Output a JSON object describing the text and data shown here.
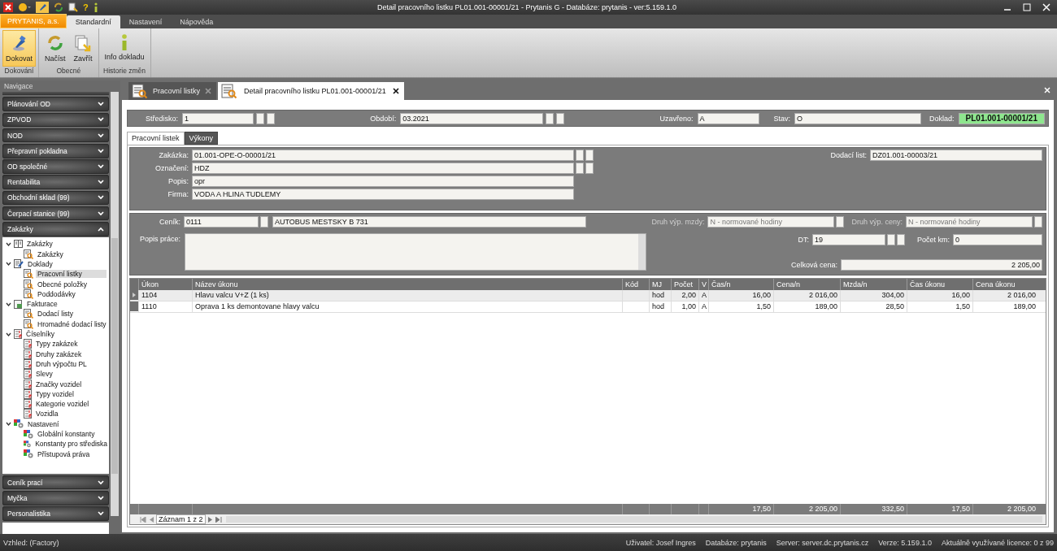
{
  "window": {
    "title": "Detail pracovního listku PL01.001-00001/21 - Prytanis G - Databáze: prytanis - ver:5.159.1.0",
    "help_glyph": "?"
  },
  "ribbon": {
    "app_tab": "PRYTANIS, a.s.",
    "tabs": [
      {
        "label": "Standardní",
        "selected": true
      },
      {
        "label": "Nastavení",
        "selected": false
      },
      {
        "label": "Nápověda",
        "selected": false
      }
    ],
    "groups": [
      {
        "label": "Dokování",
        "buttons": [
          {
            "label": "Dokovat",
            "selected": true
          }
        ]
      },
      {
        "label": "Obecné",
        "buttons": [
          {
            "label": "Načíst",
            "selected": false
          },
          {
            "label": "Zavřít",
            "selected": false
          }
        ]
      },
      {
        "label": "Historie změn",
        "buttons": [
          {
            "label": "Info dokladu",
            "selected": false
          }
        ]
      }
    ]
  },
  "navigation": {
    "title": "Navigace",
    "sections": [
      {
        "label": "Plánování OD",
        "expanded": false
      },
      {
        "label": "ZPVOD",
        "expanded": false
      },
      {
        "label": "NOD",
        "expanded": false
      },
      {
        "label": "Přepravní pokladna",
        "expanded": false
      },
      {
        "label": "OD společné",
        "expanded": false
      },
      {
        "label": "Rentabilita",
        "expanded": false
      },
      {
        "label": "Obchodní sklad (99)",
        "expanded": false
      },
      {
        "label": "Čerpací stanice (99)",
        "expanded": false
      },
      {
        "label": "Zakázky",
        "expanded": true,
        "children": [
          {
            "label": "Zakázky",
            "expanded": true,
            "children": [
              {
                "label": "Zakázky",
                "selected": false
              }
            ]
          },
          {
            "label": "Doklady",
            "expanded": true,
            "children": [
              {
                "label": "Pracovní listky",
                "selected": true
              },
              {
                "label": "Obecné položky",
                "selected": false
              },
              {
                "label": "Poddodávky",
                "selected": false
              }
            ]
          },
          {
            "label": "Fakturace",
            "expanded": true,
            "children": [
              {
                "label": "Dodací listy",
                "selected": false
              },
              {
                "label": "Hromadné dodací listy",
                "selected": false
              }
            ]
          },
          {
            "label": "Číselníky",
            "expanded": true,
            "children": [
              {
                "label": "Typy zakázek",
                "selected": false
              },
              {
                "label": "Druhy zakázek",
                "selected": false
              },
              {
                "label": "Druh výpočtu PL",
                "selected": false
              },
              {
                "label": "Slevy",
                "selected": false
              },
              {
                "label": "Značky vozidel",
                "selected": false
              },
              {
                "label": "Typy vozidel",
                "selected": false
              },
              {
                "label": "Kategorie vozidel",
                "selected": false
              },
              {
                "label": "Vozidla",
                "selected": false
              }
            ]
          },
          {
            "label": "Nastavení",
            "expanded": true,
            "children": [
              {
                "label": "Globální konstanty",
                "selected": false
              },
              {
                "label": "Konstanty pro střediska",
                "selected": false
              },
              {
                "label": "Přístupová práva",
                "selected": false
              }
            ]
          }
        ]
      },
      {
        "label": "Ceník prací",
        "expanded": false
      },
      {
        "label": "Myčka",
        "expanded": false
      },
      {
        "label": "Personalistika",
        "expanded": false
      }
    ]
  },
  "documents": [
    {
      "label": "Pracovní listky",
      "selected": false
    },
    {
      "label": "Detail pracovního listku PL01.001-00001/21",
      "selected": true
    }
  ],
  "header_fields": [
    {
      "label": "Středisko:",
      "value": "1",
      "kind": "lookup"
    },
    {
      "label": "Období:",
      "value": "03.2021",
      "kind": "lookup"
    },
    {
      "label": "Uzavřeno:",
      "value": "A",
      "kind": "plain"
    },
    {
      "label": "Stav:",
      "value": "O",
      "kind": "plain"
    },
    {
      "label": "Doklad:",
      "value": "PL01.001-00001/21",
      "kind": "badge"
    }
  ],
  "subtabs": [
    {
      "label": "Pracovní listek",
      "selected": true
    },
    {
      "label": "Výkony",
      "selected": false
    }
  ],
  "order": {
    "fields": [
      {
        "label": "Zakázka:",
        "value": "01.001-OPE-O-00001/21",
        "kind": "lookup"
      },
      {
        "label": "Označení:",
        "value": "HDZ",
        "kind": "lookup"
      },
      {
        "label": "Popis:",
        "value": "opr",
        "kind": "plain"
      },
      {
        "label": "Firma:",
        "value": "VODA A HLINA TUDLEMY",
        "kind": "plain"
      }
    ],
    "delivery_note": {
      "label": "Dodací list:",
      "value": "DZ01.001-00003/21"
    }
  },
  "work": {
    "price_list": {
      "label": "Ceník:",
      "code": "0111",
      "name": "AUTOBUS MESTSKY B 731"
    },
    "wage_calc": {
      "label": "Druh výp. mzdy:",
      "value": "N - normované hodiny",
      "disabled": true
    },
    "price_calc": {
      "label": "Druh výp. ceny:",
      "value": "N - normované hodiny",
      "disabled": true
    },
    "description": {
      "label": "Popis práce:"
    },
    "dt": {
      "label": "DT:",
      "value": "19"
    },
    "km": {
      "label": "Počet km:",
      "value": "0"
    },
    "total": {
      "label": "Celková cena:",
      "value": "2 205,00"
    }
  },
  "grid": {
    "columns": [
      {
        "label": "Úkon"
      },
      {
        "label": "Název úkonu"
      },
      {
        "label": "Kód"
      },
      {
        "label": "MJ"
      },
      {
        "label": "Počet"
      },
      {
        "label": "V"
      },
      {
        "label": "Čas/n",
        "total": "17,50"
      },
      {
        "label": "Cena/n",
        "total": "2 205,00"
      },
      {
        "label": "Mzda/n",
        "total": "332,50"
      },
      {
        "label": "Čas úkonu",
        "total": "17,50"
      },
      {
        "label": "Cena úkonu",
        "total": "2 205,00"
      }
    ],
    "rows": [
      {
        "selected": true,
        "cells": [
          "1104",
          "Hlavu valcu V+Z (1 ks)",
          null,
          "hod",
          "2,00",
          "A",
          "16,00",
          "2 016,00",
          "304,00",
          "16,00",
          "2 016,00"
        ]
      },
      {
        "selected": false,
        "cells": [
          "1110",
          "Oprava 1 ks demontovane hlavy valcu",
          null,
          "hod",
          "1,00",
          "A",
          "1,50",
          "189,00",
          "28,50",
          "1,50",
          "189,00"
        ]
      }
    ],
    "record_label": "Záznam 1 z 2"
  },
  "status_bar": {
    "left": "Vzhled: (Factory)",
    "items": [
      "Uživatel: Josef Ingres",
      "Databáze: prytanis",
      "Server: server.dc.prytanis.cz",
      "Verze: 5.159.1.0",
      "Aktuálně využívané licence: 0 z 99"
    ]
  }
}
